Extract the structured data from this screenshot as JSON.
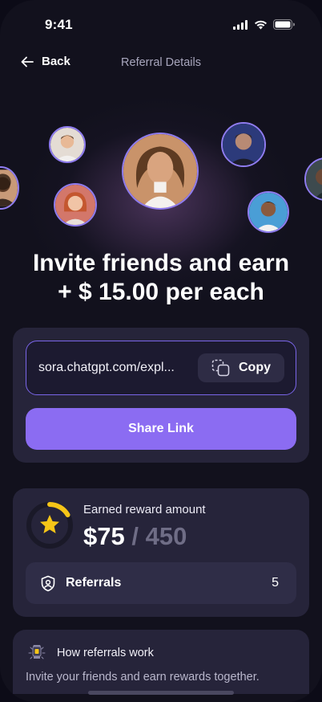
{
  "status_bar": {
    "time": "9:41"
  },
  "nav": {
    "back_label": "Back",
    "title": "Referral Details"
  },
  "hero": {
    "headline_line1": "Invite friends and earn",
    "headline_line2": "+ $ 15.00 per each"
  },
  "link_card": {
    "link_text": "sora.chatgpt.com/expl...",
    "copy_label": "Copy",
    "share_label": "Share Link"
  },
  "reward_card": {
    "title": "Earned reward amount",
    "earned": "$75",
    "separator": "/",
    "total": "450",
    "progress_fraction": 0.1667,
    "referrals_label": "Referrals",
    "referrals_count": "5"
  },
  "how_card": {
    "title": "How referrals work",
    "description": "Invite your friends and earn rewards together."
  },
  "colors": {
    "accent": "#8b6cf2",
    "card": "#26243a",
    "background": "#12111d",
    "star": "#f5c518"
  },
  "icons": [
    "arrow-left-icon",
    "signal-icon",
    "wifi-icon",
    "battery-icon",
    "copy-icon",
    "star-icon",
    "shield-user-icon",
    "lamp-icon"
  ]
}
